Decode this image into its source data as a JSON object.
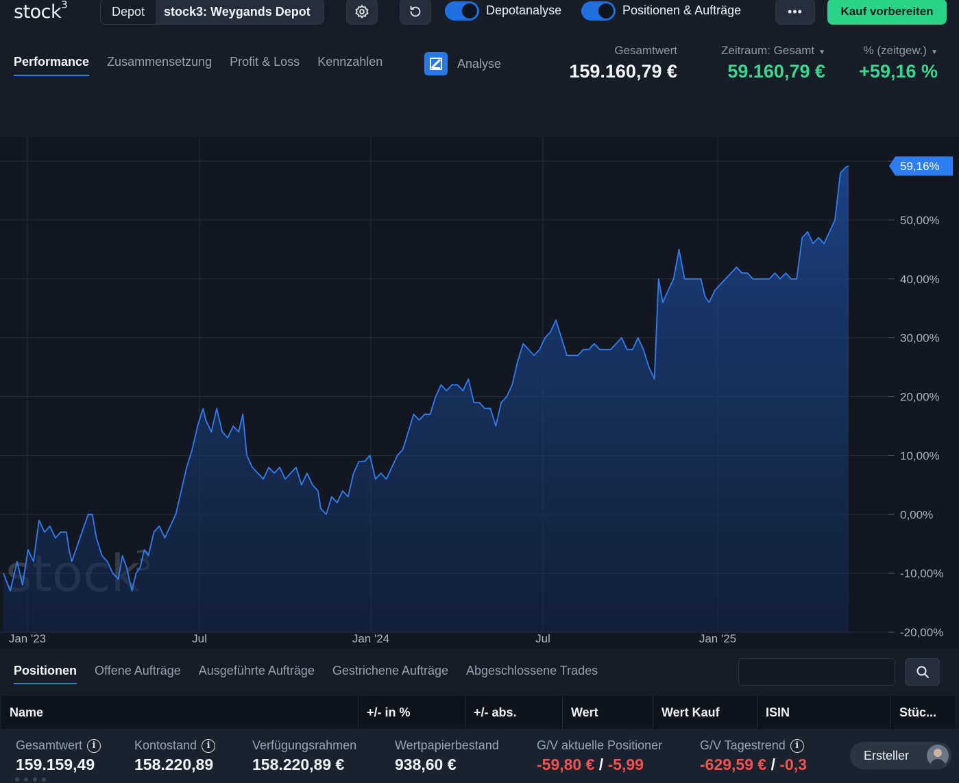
{
  "app": {
    "logo": "stock",
    "logo_sup": "3",
    "watermark": "stock",
    "watermark_sup": "3"
  },
  "topbar": {
    "depot_label": "Depot",
    "depot_name": "stock3: Weygands Depot",
    "settings_icon": "gear-icon",
    "refresh_icon": "refresh-icon",
    "toggle1": {
      "label": "Depotanalyse",
      "on": true
    },
    "toggle2": {
      "label": "Positionen & Aufträge",
      "on": true
    },
    "more_label": "•••",
    "buy_label": "Kauf vorbereiten",
    "buy_color": "#2ad388"
  },
  "tabs": [
    "Performance",
    "Zusammensetzung",
    "Profit & Loss",
    "Kennzahlen"
  ],
  "active_tab": "Performance",
  "analyse_label": "Analyse",
  "stats": {
    "total": {
      "label": "Gesamtwert",
      "value": "159.160,79 €"
    },
    "period": {
      "label": "Zeitraum: Gesamt",
      "value": "59.160,79 €"
    },
    "percent": {
      "label": "% (zeitgew.)",
      "value": "+59,16 %"
    },
    "positive_color": "#39d68f"
  },
  "chart_data": {
    "type": "area",
    "series": [
      {
        "values": [
          [
            0,
            -10
          ],
          [
            5,
            -13
          ],
          [
            10,
            -8
          ],
          [
            14,
            -12
          ],
          [
            18,
            -6
          ],
          [
            22,
            -8
          ],
          [
            26,
            -1
          ],
          [
            30,
            -3
          ],
          [
            34,
            -2
          ],
          [
            38,
            -4
          ],
          [
            42,
            -3
          ],
          [
            46,
            -3
          ],
          [
            48,
            -6
          ],
          [
            50,
            -8
          ],
          [
            53,
            -6
          ],
          [
            56,
            -4
          ],
          [
            59,
            -2
          ],
          [
            62,
            0
          ],
          [
            65,
            0
          ],
          [
            68,
            -4
          ],
          [
            72,
            -7
          ],
          [
            76,
            -8
          ],
          [
            80,
            -10
          ],
          [
            84,
            -11
          ],
          [
            87,
            -7
          ],
          [
            90,
            -9
          ],
          [
            94,
            -13
          ],
          [
            97,
            -10
          ],
          [
            100,
            -9
          ],
          [
            103,
            -6
          ],
          [
            106,
            -7
          ],
          [
            110,
            -3
          ],
          [
            114,
            -2
          ],
          [
            118,
            -4
          ],
          [
            122,
            -2
          ],
          [
            126,
            0
          ],
          [
            130,
            4
          ],
          [
            134,
            8
          ],
          [
            138,
            11
          ],
          [
            142,
            15
          ],
          [
            146,
            18
          ],
          [
            148,
            16
          ],
          [
            152,
            14
          ],
          [
            156,
            18
          ],
          [
            160,
            14
          ],
          [
            164,
            13
          ],
          [
            168,
            15
          ],
          [
            172,
            14
          ],
          [
            175,
            17
          ],
          [
            178,
            10
          ],
          [
            182,
            8
          ],
          [
            186,
            7
          ],
          [
            190,
            6
          ],
          [
            194,
            8
          ],
          [
            198,
            7
          ],
          [
            202,
            8
          ],
          [
            206,
            6
          ],
          [
            210,
            7
          ],
          [
            214,
            8
          ],
          [
            218,
            5
          ],
          [
            222,
            7
          ],
          [
            226,
            5
          ],
          [
            230,
            4
          ],
          [
            232,
            1
          ],
          [
            236,
            0
          ],
          [
            240,
            3
          ],
          [
            244,
            2
          ],
          [
            248,
            4
          ],
          [
            252,
            3
          ],
          [
            256,
            7
          ],
          [
            260,
            9
          ],
          [
            264,
            9
          ],
          [
            268,
            10
          ],
          [
            272,
            6
          ],
          [
            276,
            7
          ],
          [
            280,
            6
          ],
          [
            284,
            8
          ],
          [
            288,
            10
          ],
          [
            292,
            11
          ],
          [
            296,
            14
          ],
          [
            300,
            17
          ],
          [
            304,
            16
          ],
          [
            308,
            17
          ],
          [
            312,
            17
          ],
          [
            316,
            20
          ],
          [
            320,
            22
          ],
          [
            324,
            21
          ],
          [
            328,
            22
          ],
          [
            332,
            22
          ],
          [
            336,
            21
          ],
          [
            340,
            23
          ],
          [
            344,
            19
          ],
          [
            348,
            19
          ],
          [
            352,
            18
          ],
          [
            356,
            18
          ],
          [
            360,
            15
          ],
          [
            364,
            19
          ],
          [
            368,
            20
          ],
          [
            372,
            22
          ],
          [
            376,
            26
          ],
          [
            380,
            29
          ],
          [
            384,
            28
          ],
          [
            388,
            27
          ],
          [
            392,
            28
          ],
          [
            396,
            30
          ],
          [
            400,
            31
          ],
          [
            404,
            33
          ],
          [
            408,
            30
          ],
          [
            412,
            27
          ],
          [
            416,
            27
          ],
          [
            420,
            27
          ],
          [
            424,
            28
          ],
          [
            428,
            28
          ],
          [
            432,
            29
          ],
          [
            436,
            28
          ],
          [
            440,
            28
          ],
          [
            444,
            28
          ],
          [
            448,
            29
          ],
          [
            452,
            30
          ],
          [
            456,
            28
          ],
          [
            460,
            28
          ],
          [
            464,
            30
          ],
          [
            468,
            28
          ],
          [
            472,
            25
          ],
          [
            476,
            23
          ],
          [
            479,
            40
          ],
          [
            482,
            36
          ],
          [
            486,
            38
          ],
          [
            490,
            40
          ],
          [
            494,
            45
          ],
          [
            498,
            40
          ],
          [
            502,
            40
          ],
          [
            506,
            40
          ],
          [
            510,
            40
          ],
          [
            513,
            37
          ],
          [
            516,
            36
          ],
          [
            520,
            38
          ],
          [
            524,
            39
          ],
          [
            528,
            40
          ],
          [
            532,
            41
          ],
          [
            536,
            42
          ],
          [
            540,
            41
          ],
          [
            544,
            41
          ],
          [
            548,
            40
          ],
          [
            552,
            40
          ],
          [
            556,
            40
          ],
          [
            560,
            40
          ],
          [
            564,
            41
          ],
          [
            568,
            40
          ],
          [
            572,
            41
          ],
          [
            576,
            40
          ],
          [
            580,
            40
          ],
          [
            584,
            47
          ],
          [
            588,
            48
          ],
          [
            592,
            46
          ],
          [
            596,
            47
          ],
          [
            600,
            46
          ],
          [
            604,
            48
          ],
          [
            608,
            50
          ],
          [
            612,
            58
          ],
          [
            616,
            59
          ],
          [
            618,
            59.16
          ]
        ]
      }
    ],
    "x_ticks": [
      "Jan '23",
      "Jul",
      "Jan '24",
      "Jul",
      "Jan '25"
    ],
    "y_ticks": [
      "50,00%",
      "40,00%",
      "30,00%",
      "20,00%",
      "10,00%",
      "0,00%",
      "-10,00%",
      "-20,00%"
    ],
    "ylim": [
      -20,
      60
    ],
    "last_value_label": "59,16%",
    "line_color": "#2f7df2",
    "grid": true
  },
  "positions": {
    "tabs": [
      "Positionen",
      "Offene Aufträge",
      "Ausgeführte Aufträge",
      "Gestrichene Aufträge",
      "Abgeschlossene Trades"
    ],
    "active_tab": "Positionen",
    "search_placeholder": "",
    "search_icon": "search-icon",
    "columns": [
      "Name",
      "+/- in %",
      "+/- abs.",
      "Wert",
      "Wert Kauf",
      "ISIN",
      "Stüc..."
    ]
  },
  "footer": {
    "gesamtwert": {
      "label": "Gesamtwert",
      "value": "159.159,49"
    },
    "kontostand": {
      "label": "Kontostand",
      "value": "158.220,89"
    },
    "verfuegungsrahmen": {
      "label": "Verfügungsrahmen",
      "value": "158.220,89 €"
    },
    "wertpapierbestand": {
      "label": "Wertpapierbestand",
      "value": "938,60 €"
    },
    "gv_aktuell": {
      "label": "G/V aktuelle Positioner",
      "value_abs": "-59,80 €",
      "sep": "/",
      "value_pct": "-5,99"
    },
    "gv_tagestrend": {
      "label": "G/V Tagestrend",
      "value_abs": "-629,59 €",
      "sep": "/",
      "value_pct": "-0,3"
    },
    "creator_label": "Ersteller",
    "negative_color": "#ee5454"
  }
}
